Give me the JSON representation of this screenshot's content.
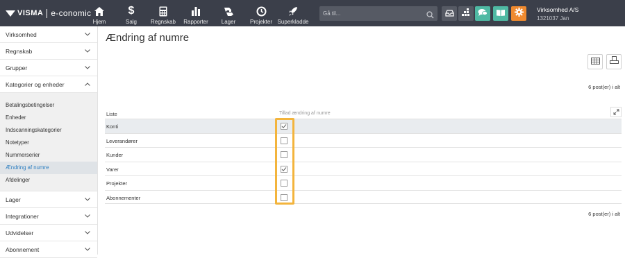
{
  "brand": {
    "name": "VISMA",
    "product": "e-conomic"
  },
  "nav": [
    {
      "id": "hjem",
      "label": "Hjem",
      "icon": "home-icon"
    },
    {
      "id": "salg",
      "label": "Salg",
      "icon": "dollar-icon"
    },
    {
      "id": "regnskab",
      "label": "Regnskab",
      "icon": "calculator-icon"
    },
    {
      "id": "rapporter",
      "label": "Rapporter",
      "icon": "bar-chart-icon"
    },
    {
      "id": "lager",
      "label": "Lager",
      "icon": "scale-icon"
    },
    {
      "id": "projekter",
      "label": "Projekter",
      "icon": "clock-icon"
    },
    {
      "id": "superkladde",
      "label": "Superkladde",
      "icon": "rocket-icon"
    }
  ],
  "search": {
    "placeholder": "Gå til..."
  },
  "toolbar_buttons": [
    {
      "name": "inbox-icon",
      "color": "#565a64"
    },
    {
      "name": "apps-icon",
      "color": "#565a64"
    },
    {
      "name": "chat-icon",
      "color": "#4fb9a3"
    },
    {
      "name": "book-icon",
      "color": "#4fb9a3"
    },
    {
      "name": "gear-icon",
      "color": "#ef8a2f"
    }
  ],
  "company": {
    "name": "Virksomhed A/S",
    "sub": "1321037 Jan"
  },
  "sidebar": {
    "sections_top": [
      {
        "label": "Virksomhed",
        "expanded": false
      },
      {
        "label": "Regnskab",
        "expanded": false
      },
      {
        "label": "Grupper",
        "expanded": false
      },
      {
        "label": "Kategorier og enheder",
        "expanded": true
      }
    ],
    "subitems": [
      {
        "label": "Betalingsbetingelser",
        "active": false
      },
      {
        "label": "Enheder",
        "active": false
      },
      {
        "label": "Indscanningskategorier",
        "active": false
      },
      {
        "label": "Notetyper",
        "active": false
      },
      {
        "label": "Nummerserier",
        "active": false
      },
      {
        "label": "Ændring af numre",
        "active": true
      },
      {
        "label": "Afdelinger",
        "active": false
      }
    ],
    "sections_bottom": [
      {
        "label": "Lager",
        "expanded": false
      },
      {
        "label": "Integrationer",
        "expanded": false
      },
      {
        "label": "Udvidelser",
        "expanded": false
      },
      {
        "label": "Abonnement",
        "expanded": false
      }
    ]
  },
  "main": {
    "title": "Ændring af numre",
    "count_top": "6 post(er) i alt",
    "count_bottom": "6 post(er) i alt",
    "table": {
      "columns": [
        "Liste",
        "Tillad ændring af numre"
      ],
      "rows": [
        {
          "label": "Konti",
          "checked": true
        },
        {
          "label": "Leverandører",
          "checked": false
        },
        {
          "label": "Kunder",
          "checked": false
        },
        {
          "label": "Varer",
          "checked": true
        },
        {
          "label": "Projekter",
          "checked": false
        },
        {
          "label": "Abonnementer",
          "checked": false
        }
      ]
    }
  },
  "colors": {
    "topbar": "#3b3f4a",
    "accent_link": "#2e7fc1",
    "highlight": "#f3b43c"
  }
}
